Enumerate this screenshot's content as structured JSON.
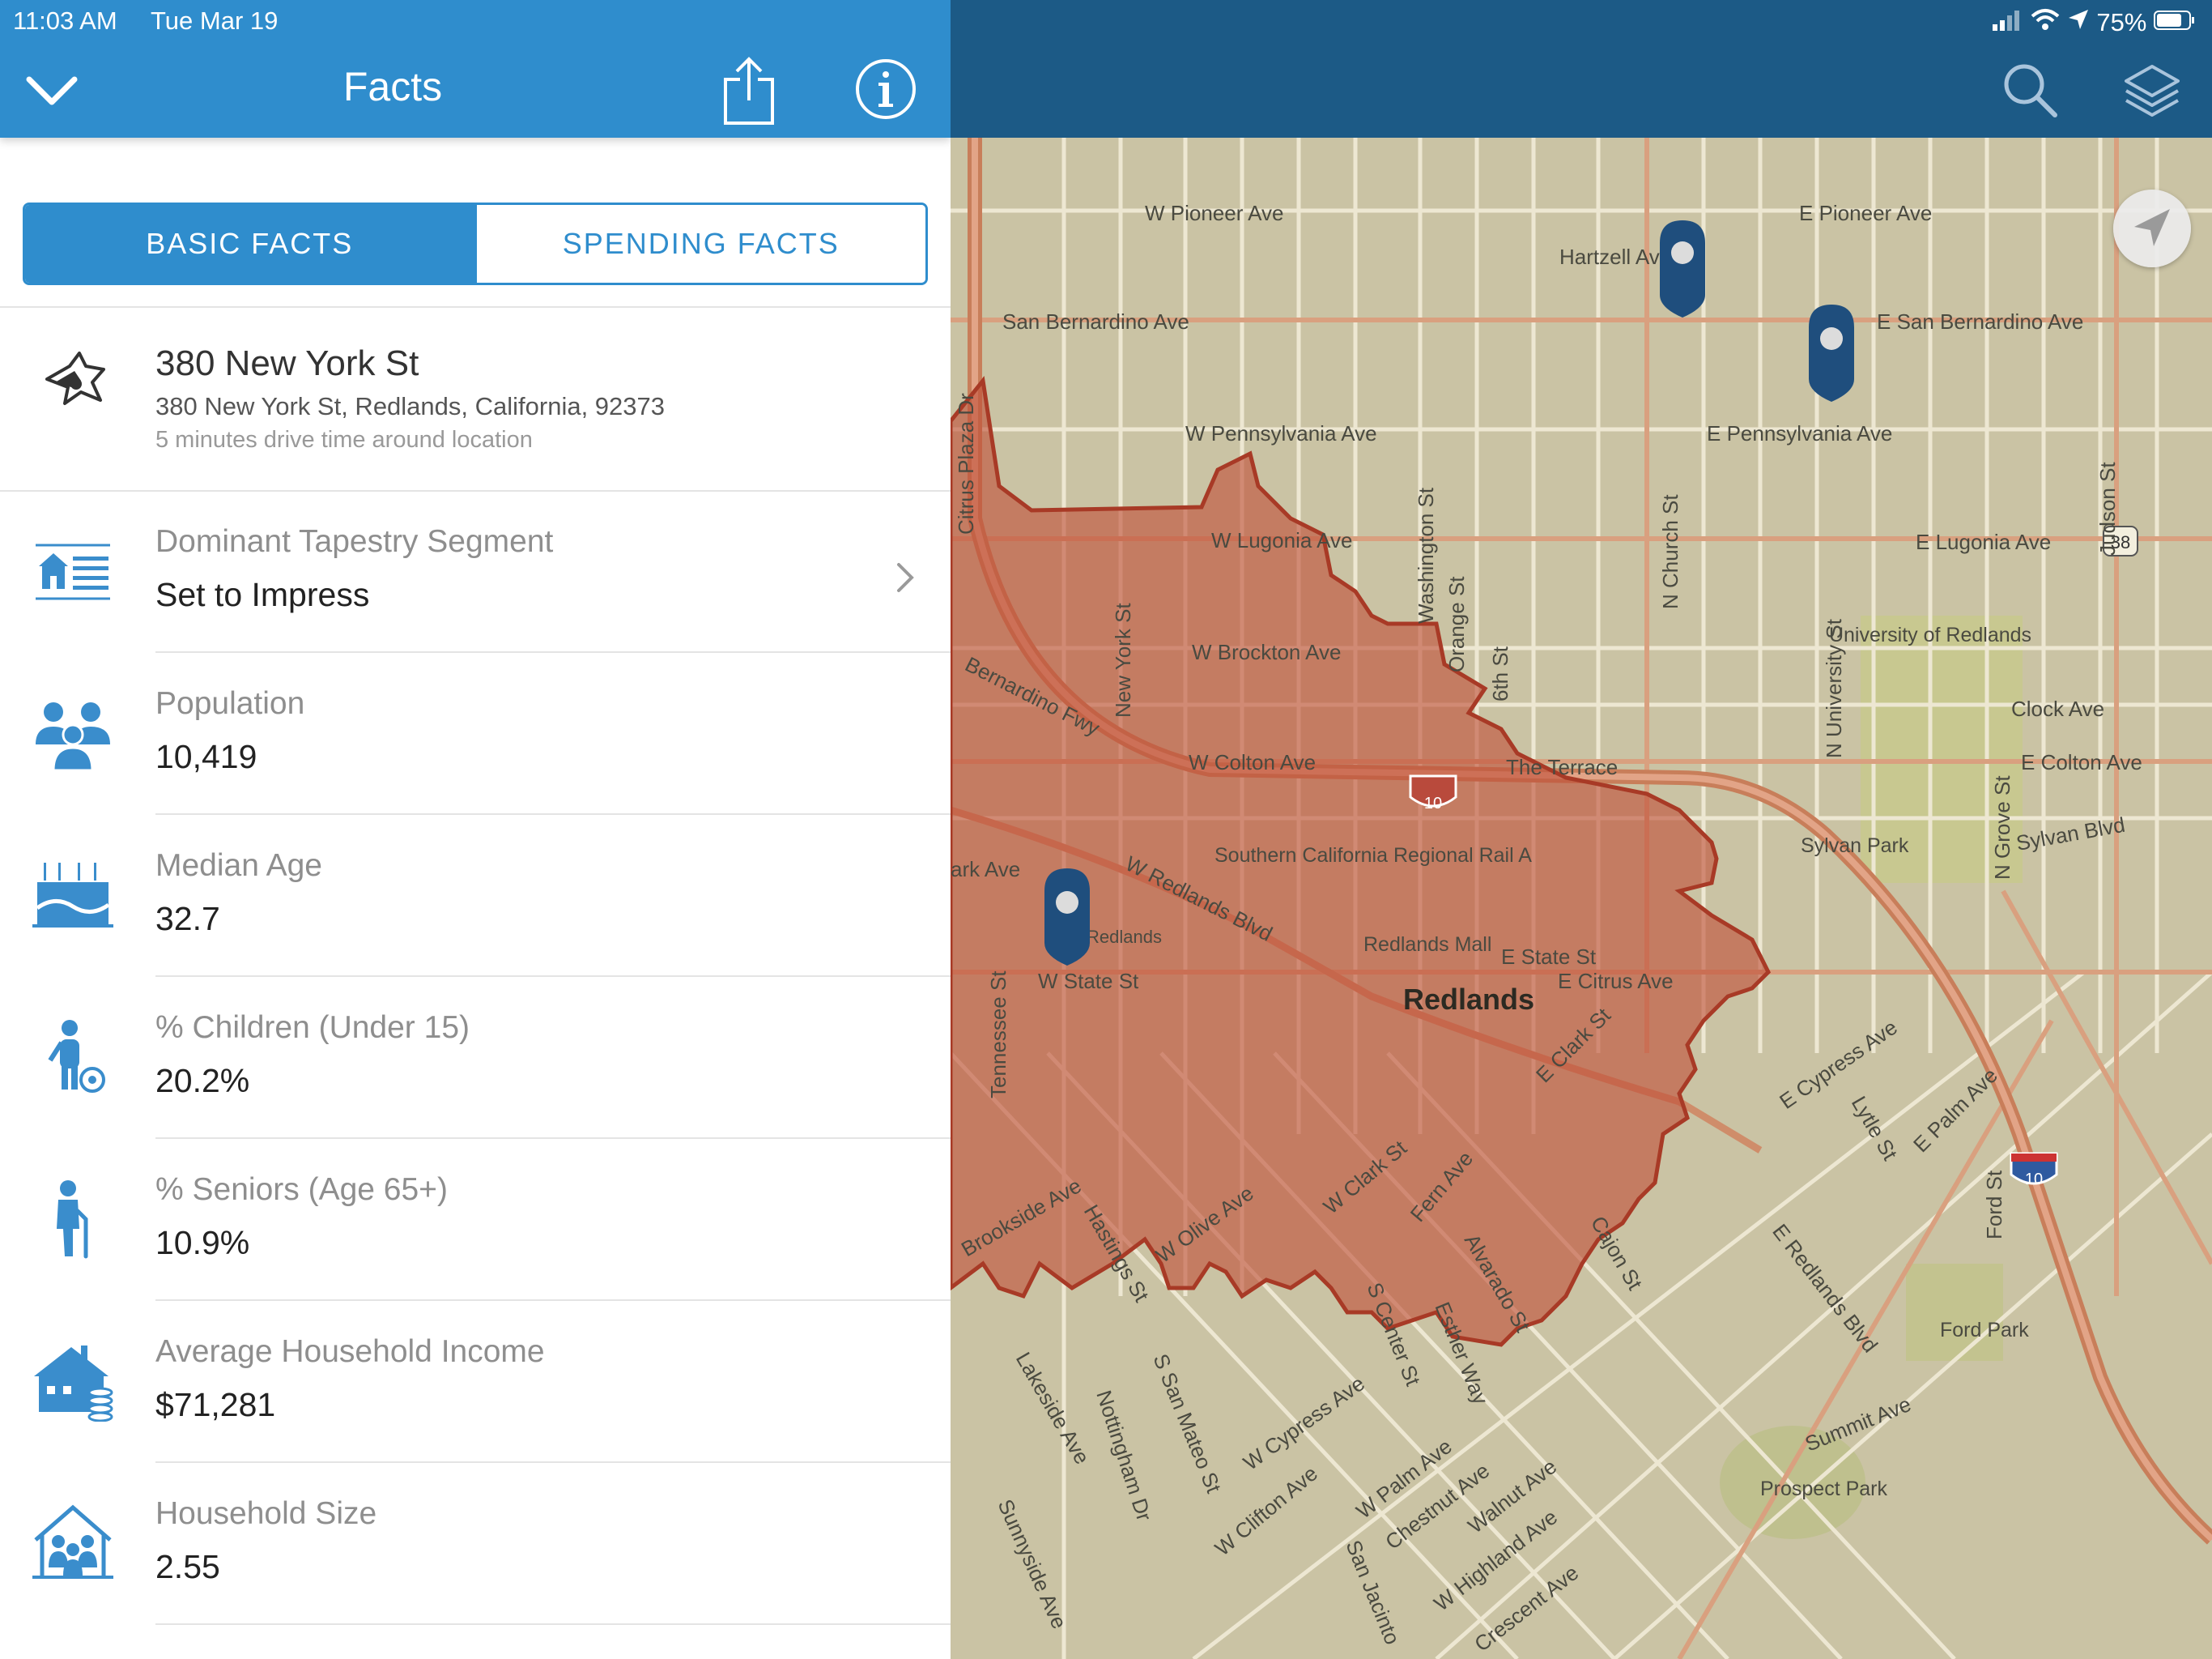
{
  "status_bar": {
    "time": "11:03 AM",
    "date": "Tue Mar 19",
    "battery": "75%"
  },
  "header": {
    "title": "Facts",
    "back_icon": "chevron-down-icon",
    "share_icon": "share-icon",
    "info_icon": "info-icon",
    "accent": "#2f8dcd",
    "map_bar": "#1c5a86"
  },
  "tabs": [
    {
      "label": "BASIC FACTS",
      "active": true
    },
    {
      "label": "SPENDING FACTS",
      "active": false
    }
  ],
  "location": {
    "title": "380 New York St",
    "address": "380 New York St, Redlands, California, 92373",
    "subtitle": "5 minutes drive time around location"
  },
  "facts": [
    {
      "label": "Dominant Tapestry Segment",
      "value": "Set to Impress",
      "icon": "tapestry-house-icon"
    },
    {
      "label": "Population",
      "value": "10,419",
      "icon": "people-icon"
    },
    {
      "label": "Median Age",
      "value": "32.7",
      "icon": "birthday-cake-icon"
    },
    {
      "label": "% Children (Under 15)",
      "value": "20.2%",
      "icon": "child-icon"
    },
    {
      "label": "% Seniors (Age 65+)",
      "value": "10.9%",
      "icon": "senior-icon"
    },
    {
      "label": "Average Household Income",
      "value": "$71,281",
      "icon": "house-money-icon"
    },
    {
      "label": "Household Size",
      "value": "2.55",
      "icon": "household-icon"
    }
  ],
  "map": {
    "area_color": "#c0503a",
    "pin_color": "#1f4e7d",
    "city_label": "Redlands",
    "highway_shield": "10",
    "route_shield": "38",
    "place_labels": [
      "University of Redlands",
      "Sylvan Park",
      "Ford Park",
      "Prospect Park",
      "Redlands Mall",
      "Southern California Regional Rail A"
    ],
    "street_labels": [
      "W Pioneer Ave",
      "E Pioneer Ave",
      "Hartzell Ave",
      "San Bernardino Ave",
      "E San Bernardino Ave",
      "W Pennsylvania Ave",
      "E Pennsylvania Ave",
      "W Lugonia Ave",
      "E Lugonia Ave",
      "W Brockton Ave",
      "W Colton Ave",
      "E Colton Ave",
      "Clock Ave",
      "The Terrace",
      "Sylvan Blvd",
      "W Redlands Blvd",
      "W State St",
      "E State St",
      "E Citrus Ave",
      "Washington St",
      "Orange St",
      "6th St",
      "N Church St",
      "N University St",
      "Judson St",
      "N Grove St",
      "New York St",
      "Tennessee St",
      "Bernardino Fwy",
      "E Clark St",
      "E Cypress Ave",
      "Lytle St",
      "E Palm Ave",
      "E Redlands Blvd",
      "Summit Ave",
      "Ford St",
      "W Olive Ave",
      "Brookside Ave",
      "Hastings St",
      "W Clark St",
      "Fern Ave",
      "Cajon St",
      "Alvarado St",
      "Esther Way",
      "S Center St",
      "W Cypress Ave",
      "S San Mateo St",
      "Lakeside Ave",
      "Nottingham Dr",
      "W Clifton Ave",
      "W Palm Ave",
      "Chestnut Ave",
      "Walnut Ave",
      "W Highland Ave",
      "San Jacinto",
      "Sunnyside Ave",
      "Crescent Ave",
      "Citrus Plaza Dr",
      "Tennessee St",
      "ark Ave",
      "Esri Redlands"
    ]
  }
}
